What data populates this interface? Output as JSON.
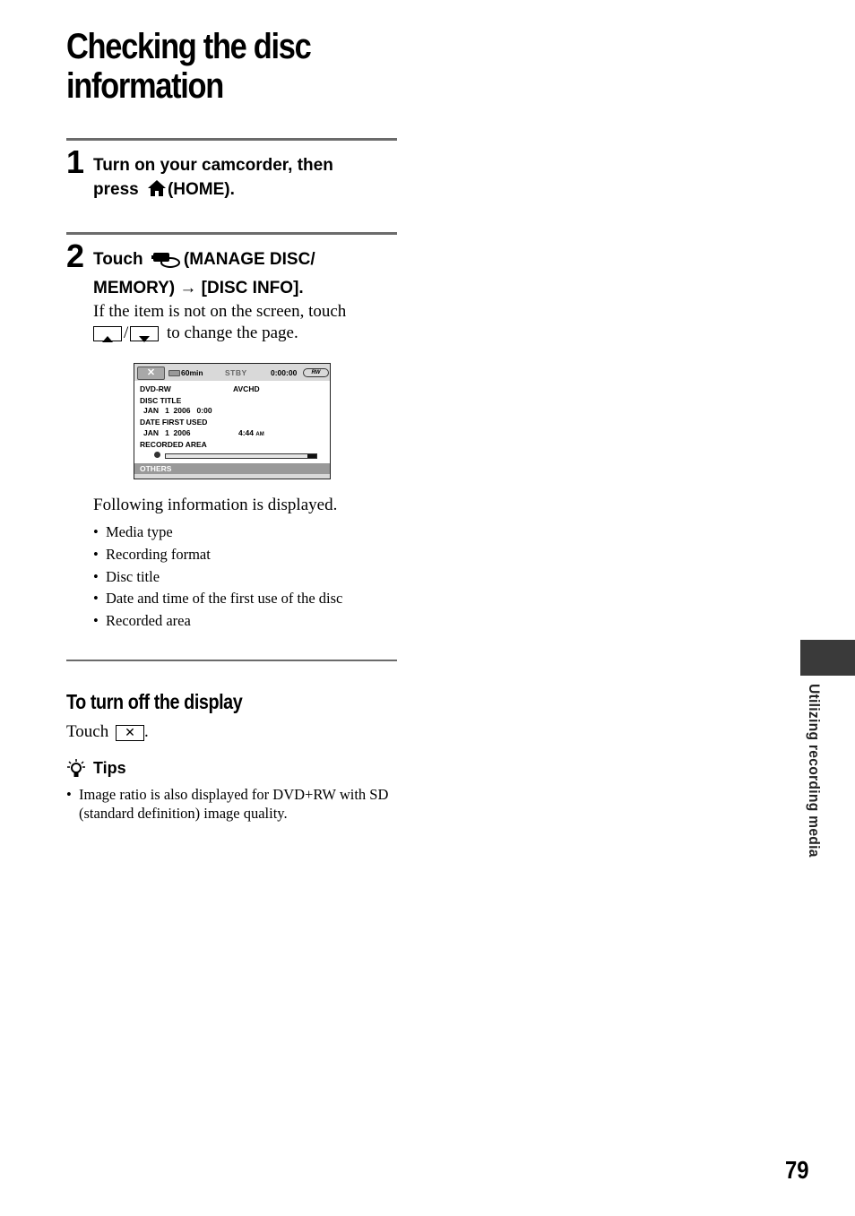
{
  "page": {
    "title_line1": "Checking the disc",
    "title_line2": "information",
    "page_number": "79",
    "side_tab_label": "Utilizing recording media"
  },
  "steps": [
    {
      "number": "1",
      "line1": "Turn on your camcorder, then",
      "line2_pre": "press",
      "icon": "home-icon",
      "line2_post": "(HOME)."
    },
    {
      "number": "2",
      "line1_pre": "Touch",
      "icon": "manage-disc-icon",
      "line1_post": "(MANAGE DISC/",
      "line2": "MEMORY) → [DISC INFO].",
      "note_line1": "If the item is not on the screen, touch",
      "note_separator": "/",
      "note_line2_post": "to change the page."
    }
  ],
  "lcd": {
    "close_label": "✕",
    "battery_time": "60min",
    "status": "STBY",
    "counter": "0:00:00",
    "media_badge": "RW",
    "media_type": "DVD-RW",
    "format": "AVCHD",
    "disc_title_label": "DISC TITLE",
    "disc_title_value": "JAN   1  2006   0:00",
    "date_first_used_label": "DATE FIRST USED",
    "date_first_used_value": "JAN   1  2006",
    "time_first_used": "4:44",
    "time_ampm": "AM",
    "recorded_area_label": "RECORDED AREA",
    "recorded_area_fraction": 0.06,
    "others_label": "OTHERS"
  },
  "info": {
    "intro": "Following information is displayed.",
    "items": [
      "Media type",
      "Recording format",
      "Disc title",
      "Date and time of the first use of the disc",
      "Recorded area"
    ]
  },
  "turn_off": {
    "heading": "To turn off the display",
    "text_pre": "Touch",
    "button_glyph": "✕",
    "text_post": "."
  },
  "tips": {
    "label": "Tips",
    "items": [
      "Image ratio is also displayed for DVD+RW with SD (standard definition) image quality."
    ]
  }
}
